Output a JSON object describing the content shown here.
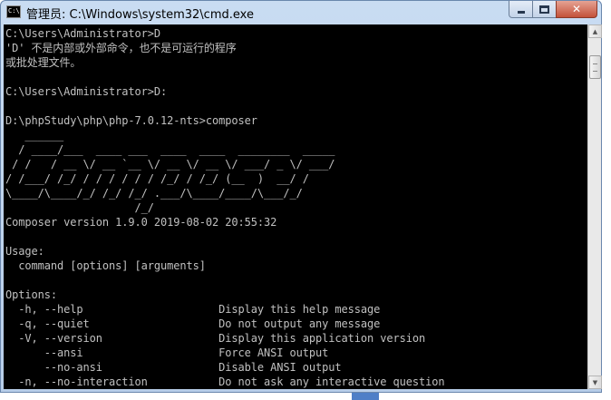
{
  "window": {
    "title": "管理员: C:\\Windows\\system32\\cmd.exe",
    "app_icon": "cmd-icon",
    "controls": [
      "minimize-icon",
      "maximize-icon",
      "close-icon"
    ],
    "close_glyph": "✕"
  },
  "console": {
    "lines": [
      "C:\\Users\\Administrator>D",
      "'D' 不是内部或外部命令，也不是可运行的程序",
      "或批处理文件。",
      "",
      "C:\\Users\\Administrator>D:",
      "",
      "D:\\phpStudy\\php\\php-7.0.12-nts>composer",
      "   ______",
      "  / ____/___  ____ ___  ____  ____  ________  _____",
      " / /   / __ \\/ __ `__ \\/ __ \\/ __ \\/ ___/ _ \\/ ___/",
      "/ /___/ /_/ / / / / / / /_/ / /_/ (__  )  __/ /",
      "\\____/\\____/_/ /_/ /_/ .___/\\____/____/\\___/_/",
      "                    /_/",
      "Composer version 1.9.0 2019-08-02 20:55:32",
      "",
      "Usage:",
      "  command [options] [arguments]",
      "",
      "Options:",
      "  -h, --help                     Display this help message",
      "  -q, --quiet                    Do not output any message",
      "  -V, --version                  Display this application version",
      "      --ansi                     Force ANSI output",
      "      --no-ansi                  Disable ANSI output",
      "  -n, --no-interaction           Do not ask any interactive question"
    ]
  },
  "scrollbar": {
    "up_glyph": "▲",
    "down_glyph": "▼"
  },
  "colors": {
    "console_bg": "#000000",
    "console_fg": "#c0c0c0",
    "titlebar": "#c9dcf2",
    "close_button": "#c3513a"
  }
}
